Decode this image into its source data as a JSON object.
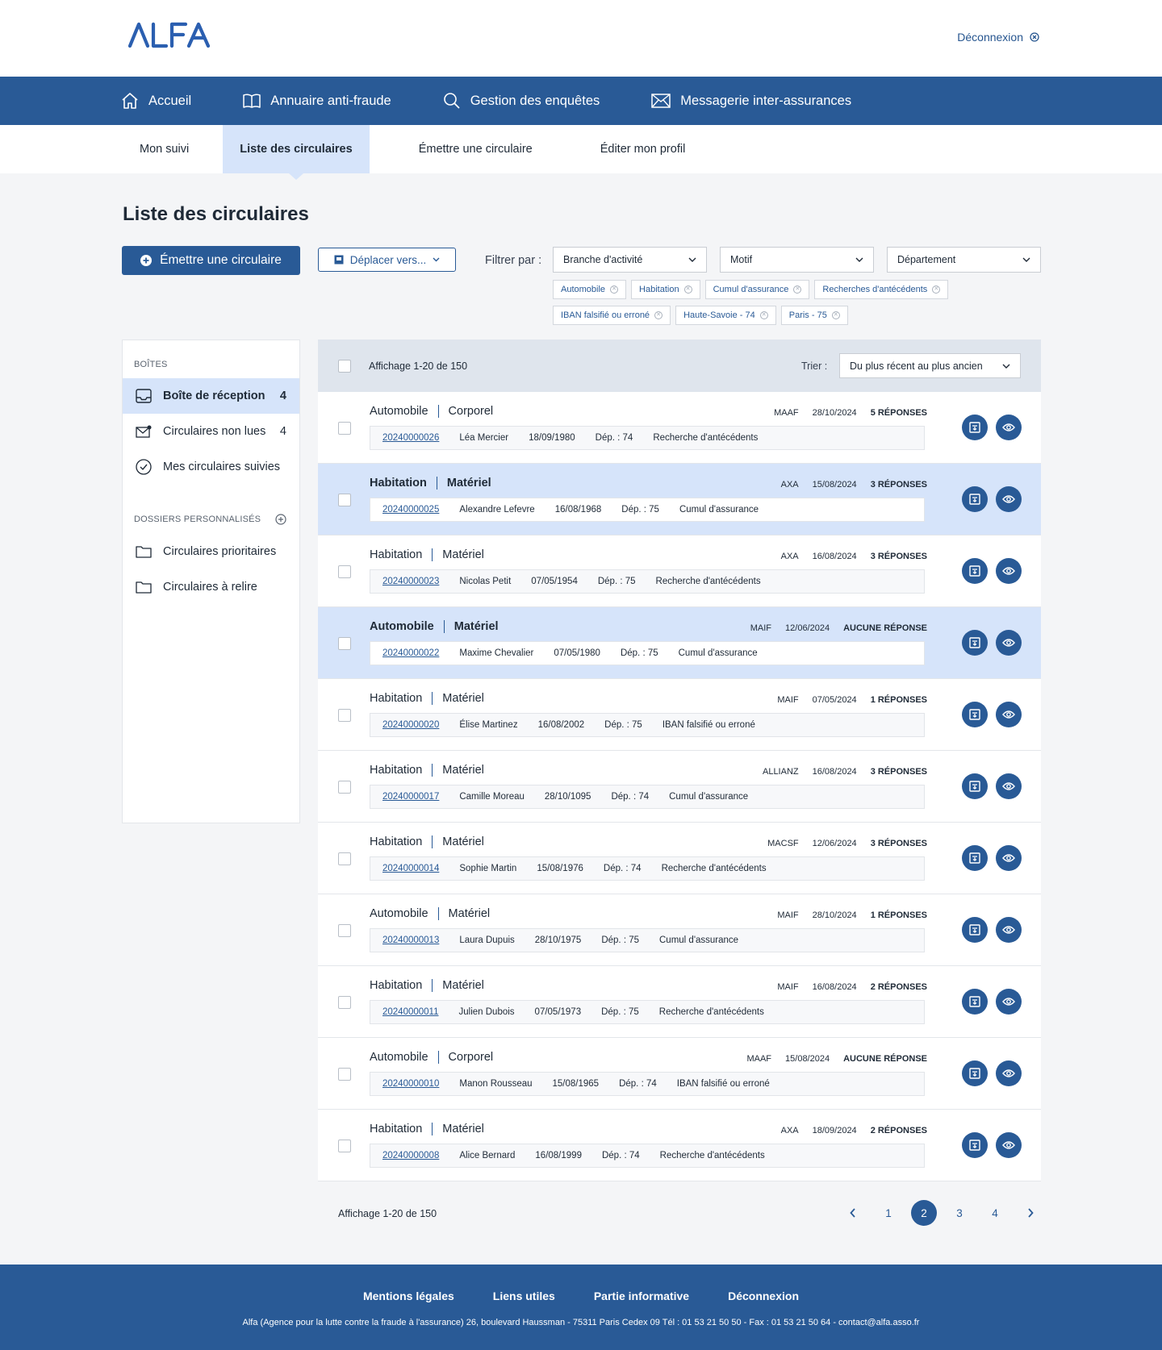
{
  "brand": {
    "logo": "ALFA",
    "logout": "Déconnexion",
    "color": "#295a96",
    "highlight": "#d6e4fa"
  },
  "nav": [
    {
      "label": "Accueil",
      "icon": "home-icon"
    },
    {
      "label": "Annuaire anti-fraude",
      "icon": "book-icon"
    },
    {
      "label": "Gestion des enquêtes",
      "icon": "search-icon"
    },
    {
      "label": "Messagerie inter-assurances",
      "icon": "mail-icon"
    }
  ],
  "subnav": [
    {
      "label": "Mon suivi",
      "active": false
    },
    {
      "label": "Liste des circulaires",
      "active": true
    },
    {
      "label": "Émettre une circulaire",
      "active": false
    },
    {
      "label": "Éditer mon profil",
      "active": false
    }
  ],
  "page": {
    "title": "Liste des circulaires",
    "emit_button": "Émettre une circulaire",
    "move_button": "Déplacer vers...",
    "filter_label": "Filtrer par :"
  },
  "filters": [
    {
      "label": "Branche d'activité"
    },
    {
      "label": "Motif"
    },
    {
      "label": "Département"
    }
  ],
  "chips": [
    "Automobile",
    "Habitation",
    "Cumul d'assurance",
    "Recherches d'antécédents",
    "IBAN falsifié ou erroné",
    "Haute-Savoie - 74",
    "Paris - 75"
  ],
  "sidebar": {
    "boxes_title": "BOÎTES",
    "items": [
      {
        "label": "Boîte de réception",
        "count": "4",
        "icon": "inbox-icon",
        "active": true
      },
      {
        "label": "Circulaires non lues",
        "count": "4",
        "icon": "mail-unread-icon",
        "active": false
      },
      {
        "label": "Mes circulaires suivies",
        "count": "",
        "icon": "check-circle-icon",
        "active": false
      }
    ],
    "folders_title": "DOSSIERS PERSONNALISÉS",
    "folders": [
      {
        "label": "Circulaires prioritaires",
        "icon": "folder-icon"
      },
      {
        "label": "Circulaires à relire",
        "icon": "folder-icon"
      }
    ]
  },
  "list": {
    "count_text": "Affichage 1-20 de 150",
    "sort_label": "Trier :",
    "sort_value": "Du plus récent au plus ancien",
    "rows": [
      {
        "branch": "Automobile",
        "type": "Corporel",
        "insurer": "MAAF",
        "date": "28/10/2024",
        "replies": "5 RÉPONSES",
        "ref": "20240000026",
        "name": "Léa Mercier",
        "birth": "18/09/1980",
        "dep": "Dép. : 74",
        "motif": "Recherche d'antécédents",
        "highlight": false
      },
      {
        "branch": "Habitation",
        "type": "Matériel",
        "insurer": "AXA",
        "date": "15/08/2024",
        "replies": "3 RÉPONSES",
        "ref": "20240000025",
        "name": "Alexandre Lefevre",
        "birth": "16/08/1968",
        "dep": "Dép. : 75",
        "motif": "Cumul d'assurance",
        "highlight": true
      },
      {
        "branch": "Habitation",
        "type": "Matériel",
        "insurer": "AXA",
        "date": "16/08/2024",
        "replies": "3 RÉPONSES",
        "ref": "20240000023",
        "name": "Nicolas Petit",
        "birth": "07/05/1954",
        "dep": "Dép. : 75",
        "motif": "Recherche d'antécédents",
        "highlight": false
      },
      {
        "branch": "Automobile",
        "type": "Matériel",
        "insurer": "MAIF",
        "date": "12/06/2024",
        "replies": "AUCUNE RÉPONSE",
        "ref": "20240000022",
        "name": "Maxime Chevalier",
        "birth": "07/05/1980",
        "dep": "Dép. : 75",
        "motif": "Cumul d'assurance",
        "highlight": true
      },
      {
        "branch": "Habitation",
        "type": "Matériel",
        "insurer": "MAIF",
        "date": "07/05/2024",
        "replies": "1 RÉPONSES",
        "ref": "20240000020",
        "name": "Élise Martinez",
        "birth": "16/08/2002",
        "dep": "Dép. : 75",
        "motif": "IBAN falsifié ou erroné",
        "highlight": false
      },
      {
        "branch": "Habitation",
        "type": "Matériel",
        "insurer": "ALLIANZ",
        "date": "16/08/2024",
        "replies": "3 RÉPONSES",
        "ref": "20240000017",
        "name": "Camille Moreau",
        "birth": "28/10/1095",
        "dep": "Dép. : 74",
        "motif": "Cumul d'assurance",
        "highlight": false
      },
      {
        "branch": "Habitation",
        "type": "Matériel",
        "insurer": "MACSF",
        "date": "12/06/2024",
        "replies": "3 RÉPONSES",
        "ref": "20240000014",
        "name": "Sophie Martin",
        "birth": "15/08/1976",
        "dep": "Dép. : 74",
        "motif": "Recherche d'antécédents",
        "highlight": false
      },
      {
        "branch": "Automobile",
        "type": "Matériel",
        "insurer": "MAIF",
        "date": "28/10/2024",
        "replies": "1 RÉPONSES",
        "ref": "20240000013",
        "name": "Laura Dupuis",
        "birth": "28/10/1975",
        "dep": "Dép. : 75",
        "motif": "Cumul d'assurance",
        "highlight": false
      },
      {
        "branch": "Habitation",
        "type": "Matériel",
        "insurer": "MAIF",
        "date": "16/08/2024",
        "replies": "2 RÉPONSES",
        "ref": "20240000011",
        "name": "Julien Dubois",
        "birth": "07/05/1973",
        "dep": "Dép. : 75",
        "motif": "Recherche d'antécédents",
        "highlight": false
      },
      {
        "branch": "Automobile",
        "type": "Corporel",
        "insurer": "MAAF",
        "date": "15/08/2024",
        "replies": "AUCUNE RÉPONSE",
        "ref": "20240000010",
        "name": "Manon Rousseau",
        "birth": "15/08/1965",
        "dep": "Dép. : 74",
        "motif": "IBAN falsifié ou erroné",
        "highlight": false
      },
      {
        "branch": "Habitation",
        "type": "Matériel",
        "insurer": "AXA",
        "date": "18/09/2024",
        "replies": "2 RÉPONSES",
        "ref": "20240000008",
        "name": "Alice Bernard",
        "birth": "16/08/1999",
        "dep": "Dép. : 74",
        "motif": "Recherche d'antécédents",
        "highlight": false
      }
    ]
  },
  "pagination": {
    "count_text": "Affichage 1-20 de 150",
    "pages": [
      "1",
      "2",
      "3",
      "4"
    ],
    "current": "2"
  },
  "footer": {
    "links": [
      "Mentions légales",
      "Liens utiles",
      "Partie informative",
      "Déconnexion"
    ],
    "address": "Alfa (Agence pour la lutte contre la fraude à l'assurance) 26, boulevard Haussman - 75311 Paris Cedex 09 Tél : 01 53 21 50 50 - Fax : 01 53 21 50 64 - contact@alfa.asso.fr"
  }
}
